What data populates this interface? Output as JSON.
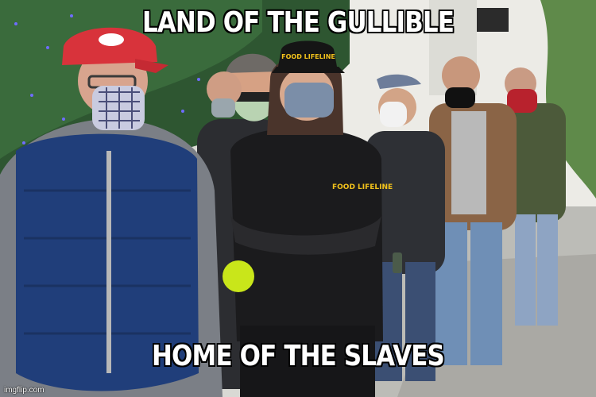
{
  "meme": {
    "top_text": "LAND OF THE GULLIBLE",
    "bottom_text": "HOME OF THE SLAVES",
    "watermark": "imgflip.com"
  },
  "photo": {
    "cap_logo_text": "FOOD LIFELINE",
    "jacket_logo_text": "FOOD LIFELINE"
  },
  "colors": {
    "sky": "#e8e8e4",
    "tree": "#2f5a32",
    "vest": "#1f3d78",
    "jacket": "#1a1a1a",
    "red_cap": "#d8323a",
    "sidewalk": "#b9b9b4"
  }
}
